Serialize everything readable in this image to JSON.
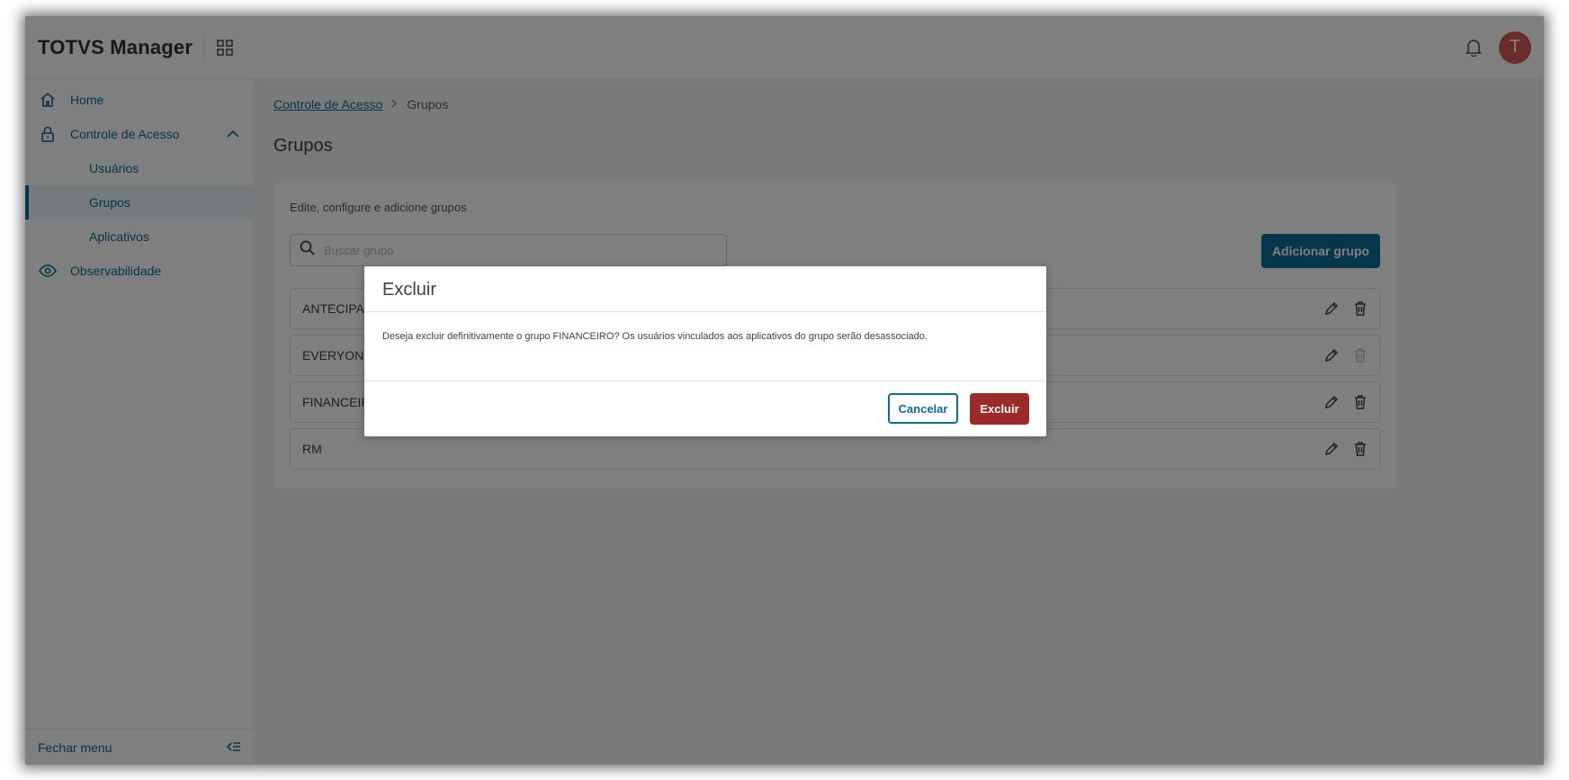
{
  "header": {
    "brand": "TOTVS Manager",
    "avatar_initial": "T"
  },
  "sidebar": {
    "items": [
      {
        "label": "Home",
        "icon": "home-icon"
      },
      {
        "label": "Controle de Acesso",
        "icon": "lock-icon"
      },
      {
        "label": "Observabilidade",
        "icon": "eye-icon"
      }
    ],
    "subitems": [
      {
        "label": "Usuários"
      },
      {
        "label": "Grupos"
      },
      {
        "label": "Aplicativos"
      }
    ],
    "footer_label": "Fechar menu"
  },
  "breadcrumb": {
    "parent": "Controle de Acesso",
    "current": "Grupos"
  },
  "page": {
    "title": "Grupos",
    "description": "Edite, configure e adicione grupos",
    "search_placeholder": "Buscar grupo",
    "add_label": "Adicionar grupo"
  },
  "groups": [
    {
      "name": "ANTECIPA"
    },
    {
      "name": "EVERYONE"
    },
    {
      "name": "FINANCEIRO"
    },
    {
      "name": "RM"
    }
  ],
  "modal": {
    "title": "Excluir",
    "message": "Deseja excluir definitivamente o grupo FINANCEIRO? Os usuários vinculados aos aplicativos do grupo serão desassociado.",
    "cancel_label": "Cancelar",
    "confirm_label": "Excluir"
  },
  "colors": {
    "primary": "#0c6c94",
    "danger": "#9e2a27",
    "avatar": "#d65a55"
  }
}
